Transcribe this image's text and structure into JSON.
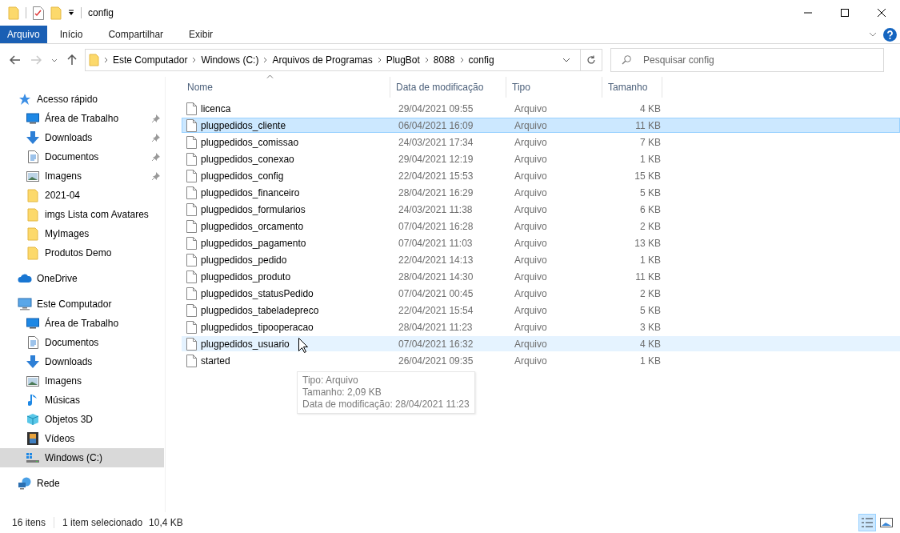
{
  "window": {
    "title": "config"
  },
  "ribbon": {
    "tabs": [
      {
        "label": "Arquivo",
        "kind": "file"
      },
      {
        "label": "Início",
        "kind": "tab"
      },
      {
        "label": "Compartilhar",
        "kind": "tab"
      },
      {
        "label": "Exibir",
        "kind": "tab"
      }
    ]
  },
  "address_bar": {
    "path": [
      "Este Computador",
      "Windows (C:)",
      "Arquivos de Programas",
      "PlugBot",
      "8088",
      "config"
    ]
  },
  "search": {
    "placeholder": "Pesquisar config"
  },
  "sidebar": {
    "items": [
      {
        "label": "Acesso rápido",
        "kind": "star",
        "selected": false,
        "children": [
          {
            "label": "Área de Trabalho",
            "kind": "desktop",
            "pinned": true,
            "selected": false
          },
          {
            "label": "Downloads",
            "kind": "download",
            "pinned": true,
            "selected": false
          },
          {
            "label": "Documentos",
            "kind": "document",
            "pinned": true,
            "selected": false
          },
          {
            "label": "Imagens",
            "kind": "pictures",
            "pinned": true,
            "selected": false
          },
          {
            "label": "2021-04",
            "kind": "folder",
            "pinned": false,
            "selected": false
          },
          {
            "label": "imgs Lista com Avatares",
            "kind": "folder",
            "pinned": false,
            "selected": false
          },
          {
            "label": "MyImages",
            "kind": "folder",
            "pinned": false,
            "selected": false
          },
          {
            "label": "Produtos Demo",
            "kind": "folder",
            "pinned": false,
            "selected": false
          }
        ]
      },
      {
        "label": "OneDrive",
        "kind": "cloud",
        "selected": false
      },
      {
        "label": "Este Computador",
        "kind": "computer",
        "selected": false,
        "children": [
          {
            "label": "Área de Trabalho",
            "kind": "desktop",
            "selected": false
          },
          {
            "label": "Documentos",
            "kind": "document",
            "selected": false
          },
          {
            "label": "Downloads",
            "kind": "download",
            "selected": false
          },
          {
            "label": "Imagens",
            "kind": "pictures",
            "selected": false
          },
          {
            "label": "Músicas",
            "kind": "music",
            "selected": false
          },
          {
            "label": "Objetos 3D",
            "kind": "cube",
            "selected": false
          },
          {
            "label": "Vídeos",
            "kind": "video",
            "selected": false
          },
          {
            "label": "Windows (C:)",
            "kind": "drive",
            "selected": true
          }
        ]
      },
      {
        "label": "Rede",
        "kind": "network",
        "selected": false
      }
    ]
  },
  "table": {
    "columns": [
      "Nome",
      "Data de modificação",
      "Tipo",
      "Tamanho"
    ],
    "rows": [
      {
        "name": "licenca",
        "date": "29/04/2021 09:55",
        "type": "Arquivo",
        "size": "4 KB",
        "selected": false,
        "hovered": false
      },
      {
        "name": "plugpedidos_cliente",
        "date": "06/04/2021 16:09",
        "type": "Arquivo",
        "size": "11 KB",
        "selected": true,
        "hovered": false
      },
      {
        "name": "plugpedidos_comissao",
        "date": "24/03/2021 17:34",
        "type": "Arquivo",
        "size": "7 KB",
        "selected": false,
        "hovered": false
      },
      {
        "name": "plugpedidos_conexao",
        "date": "29/04/2021 12:19",
        "type": "Arquivo",
        "size": "1 KB",
        "selected": false,
        "hovered": false
      },
      {
        "name": "plugpedidos_config",
        "date": "22/04/2021 15:53",
        "type": "Arquivo",
        "size": "15 KB",
        "selected": false,
        "hovered": false
      },
      {
        "name": "plugpedidos_financeiro",
        "date": "28/04/2021 16:29",
        "type": "Arquivo",
        "size": "5 KB",
        "selected": false,
        "hovered": false
      },
      {
        "name": "plugpedidos_formularios",
        "date": "24/03/2021 11:38",
        "type": "Arquivo",
        "size": "6 KB",
        "selected": false,
        "hovered": false
      },
      {
        "name": "plugpedidos_orcamento",
        "date": "07/04/2021 16:28",
        "type": "Arquivo",
        "size": "2 KB",
        "selected": false,
        "hovered": false
      },
      {
        "name": "plugpedidos_pagamento",
        "date": "07/04/2021 11:03",
        "type": "Arquivo",
        "size": "13 KB",
        "selected": false,
        "hovered": false
      },
      {
        "name": "plugpedidos_pedido",
        "date": "22/04/2021 14:13",
        "type": "Arquivo",
        "size": "1 KB",
        "selected": false,
        "hovered": false
      },
      {
        "name": "plugpedidos_produto",
        "date": "28/04/2021 14:30",
        "type": "Arquivo",
        "size": "11 KB",
        "selected": false,
        "hovered": false
      },
      {
        "name": "plugpedidos_statusPedido",
        "date": "07/04/2021 00:45",
        "type": "Arquivo",
        "size": "2 KB",
        "selected": false,
        "hovered": false
      },
      {
        "name": "plugpedidos_tabeladepreco",
        "date": "22/04/2021 15:54",
        "type": "Arquivo",
        "size": "5 KB",
        "selected": false,
        "hovered": false
      },
      {
        "name": "plugpedidos_tipooperacao",
        "date": "28/04/2021 11:23",
        "type": "Arquivo",
        "size": "3 KB",
        "selected": false,
        "hovered": false
      },
      {
        "name": "plugpedidos_usuario",
        "date": "07/04/2021 16:32",
        "type": "Arquivo",
        "size": "4 KB",
        "selected": false,
        "hovered": true
      },
      {
        "name": "started",
        "date": "26/04/2021 09:35",
        "type": "Arquivo",
        "size": "1 KB",
        "selected": false,
        "hovered": false
      }
    ]
  },
  "tooltip": {
    "lines": [
      "Tipo: Arquivo",
      "Tamanho: 2,09 KB",
      "Data de modificação: 28/04/2021 11:23"
    ]
  },
  "status_bar": {
    "item_count": "16 itens",
    "selection": "1 item selecionado",
    "selection_size": "10,4 KB",
    "views": [
      {
        "kind": "details",
        "selected": true
      },
      {
        "kind": "large-icons",
        "selected": false
      }
    ]
  }
}
